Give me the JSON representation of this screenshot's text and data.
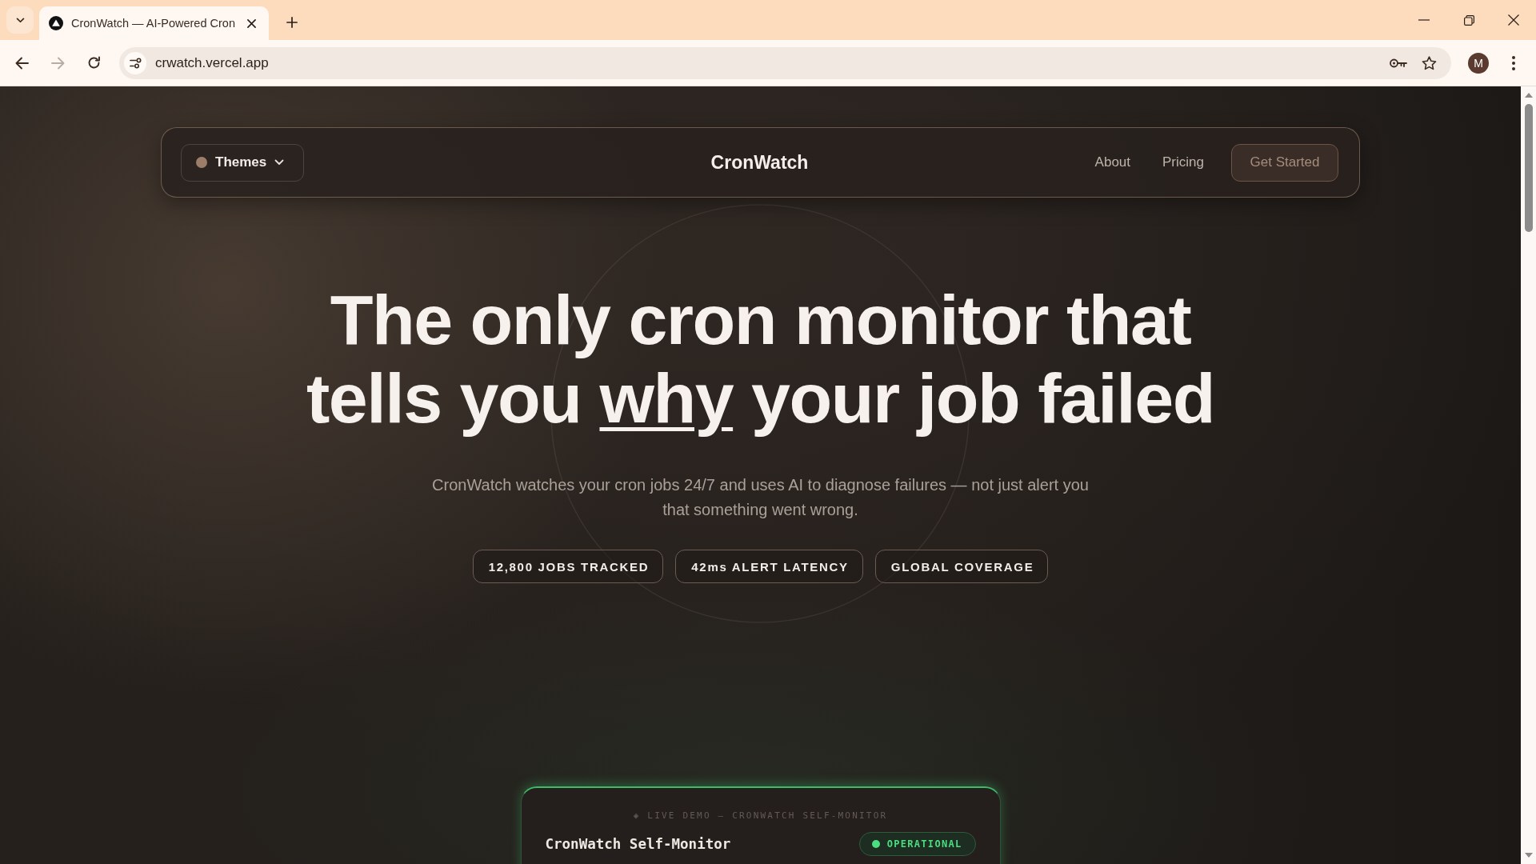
{
  "browser": {
    "tabs": [
      {
        "title": "CronWatch — AI-Powered Cron",
        "selected": true
      }
    ],
    "address": "crwatch.vercel.app",
    "forward_disabled": true,
    "profile_initial": "M"
  },
  "nav": {
    "theme_button": "Themes",
    "brand": "CronWatch",
    "links": [
      "About",
      "Pricing"
    ],
    "cta": "Get Started"
  },
  "hero": {
    "headline": {
      "before": "The only cron monitor that tells you ",
      "underlined": "why",
      "after": " your job failed"
    },
    "subtitle": "CronWatch watches your cron jobs 24/7 and uses AI to diagnose failures — not just alert you that something went wrong.",
    "stats": [
      "12,800 JOBS TRACKED",
      "42ms ALERT LATENCY",
      "GLOBAL COVERAGE"
    ]
  },
  "demo_card": {
    "eyebrow": "◈ LIVE DEMO — CRONWATCH SELF-MONITOR",
    "title": "CronWatch Self-Monitor",
    "status": {
      "kind": "operational",
      "label": "OPERATIONAL"
    }
  }
}
